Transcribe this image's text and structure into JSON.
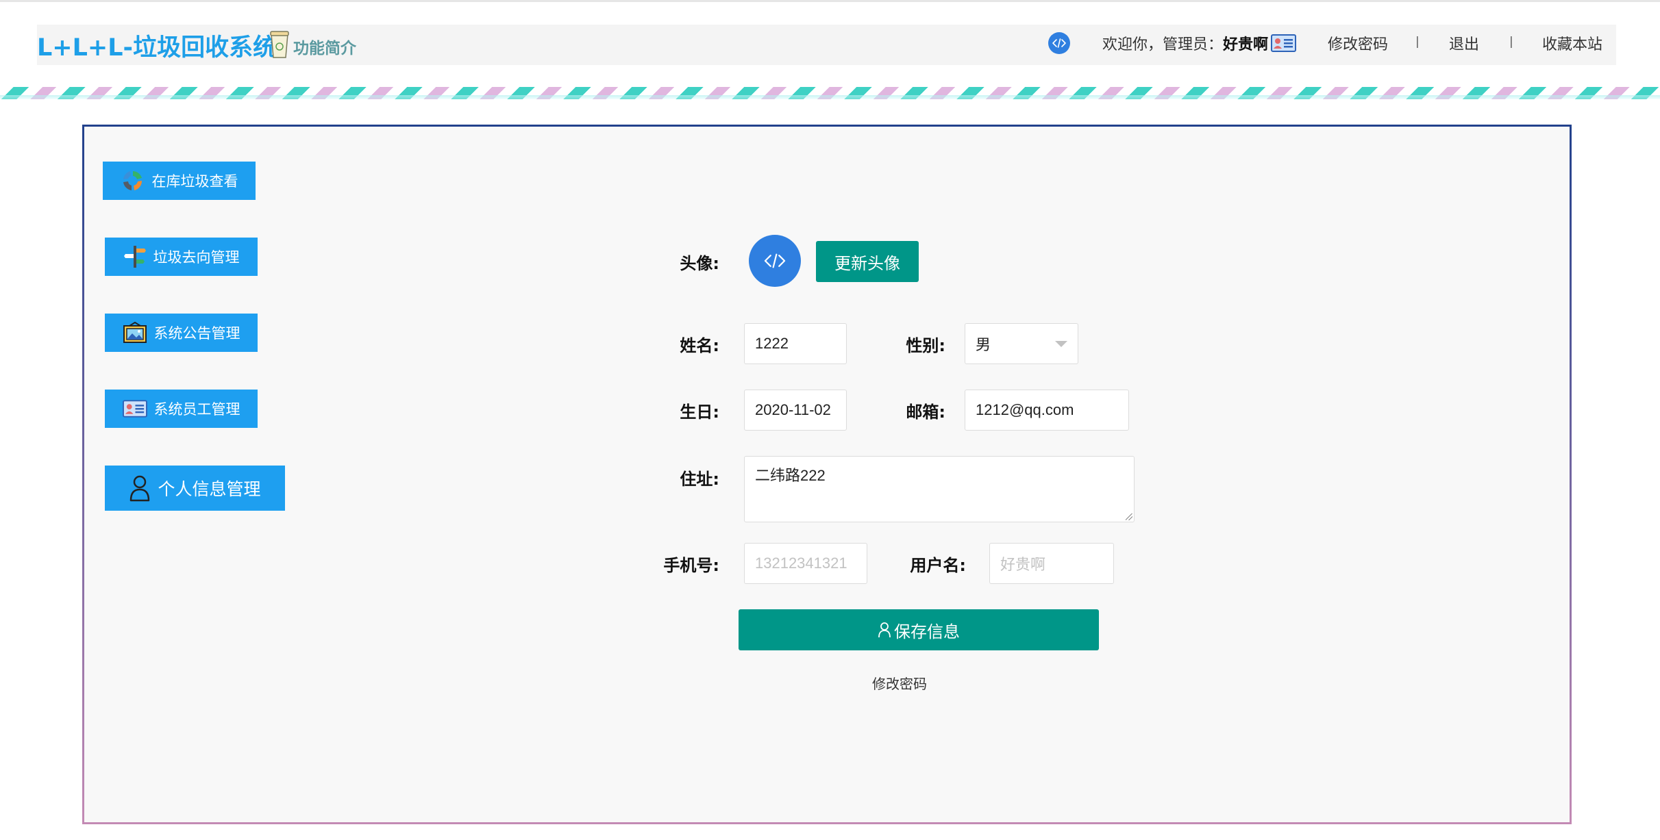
{
  "header": {
    "app_title": "L+L+L-垃圾回收系统",
    "intro_link": "功能简介",
    "welcome_prefix": "欢迎你，管理员：",
    "username": "好贵啊",
    "change_password": "修改密码",
    "sep1": "|",
    "logout": "退出",
    "sep2": "|",
    "bookmark": "收藏本站"
  },
  "sidebar": {
    "items": [
      {
        "label": "在库垃圾查看",
        "icon": "recycle-icon"
      },
      {
        "label": "垃圾去向管理",
        "icon": "signpost-icon"
      },
      {
        "label": "系统公告管理",
        "icon": "picture-icon"
      },
      {
        "label": "系统员工管理",
        "icon": "id-card-icon"
      },
      {
        "label": "个人信息管理",
        "icon": "user-icon"
      }
    ]
  },
  "form": {
    "avatar_label": "头像:",
    "update_avatar": "更新头像",
    "name_label": "姓名:",
    "name_value": "1222",
    "gender_label": "性别:",
    "gender_value": "男",
    "birthday_label": "生日:",
    "birthday_value": "2020-11-02",
    "email_label": "邮箱:",
    "email_value": "1212@qq.com",
    "address_label": "住址:",
    "address_value": "二纬路222",
    "phone_label": "手机号:",
    "phone_placeholder": "13212341321",
    "username_label": "用户名:",
    "username_placeholder": "好贵啊",
    "save_button": "保存信息",
    "change_password": "修改密码"
  },
  "colors": {
    "brand_blue": "#1e9fe8",
    "sidebar_button": "#1e9ff0",
    "teal_button": "#009688",
    "avatar_blue": "#2f7fe0",
    "stripe_teal": "#3fd1c4",
    "stripe_pink": "#e0b6df"
  }
}
